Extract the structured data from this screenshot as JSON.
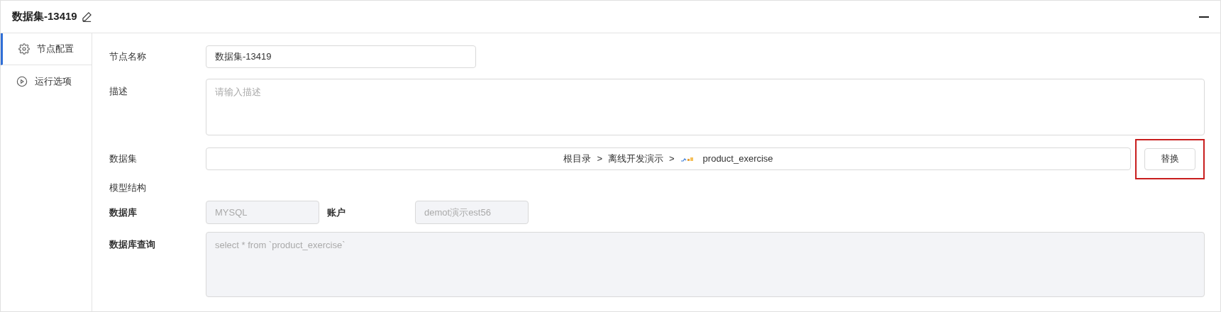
{
  "title": "数据集-13419",
  "tabs": [
    {
      "label": "节点配置",
      "selected": true,
      "kind": "gear"
    },
    {
      "label": "运行选项",
      "selected": false,
      "kind": "play"
    }
  ],
  "form": {
    "name_label": "节点名称",
    "name_value": "数据集-13419",
    "desc_label": "描述",
    "desc_placeholder": "请输入描述",
    "dataset_label": "数据集",
    "dataset_path": [
      {
        "text": "根目录"
      },
      {
        "text": ">"
      },
      {
        "text": "离线开发演示"
      },
      {
        "text": ">"
      }
    ],
    "dataset_name": "product_exercise",
    "replace_button": "替换",
    "replace_highlighted": true,
    "model_label": "模型结构",
    "db_label": "数据库",
    "db_value": "MYSQL",
    "account_label": "账户",
    "account_value": "demot演示est56",
    "query_label": "数据库查询",
    "query_value": "select * from `product_exercise`"
  }
}
